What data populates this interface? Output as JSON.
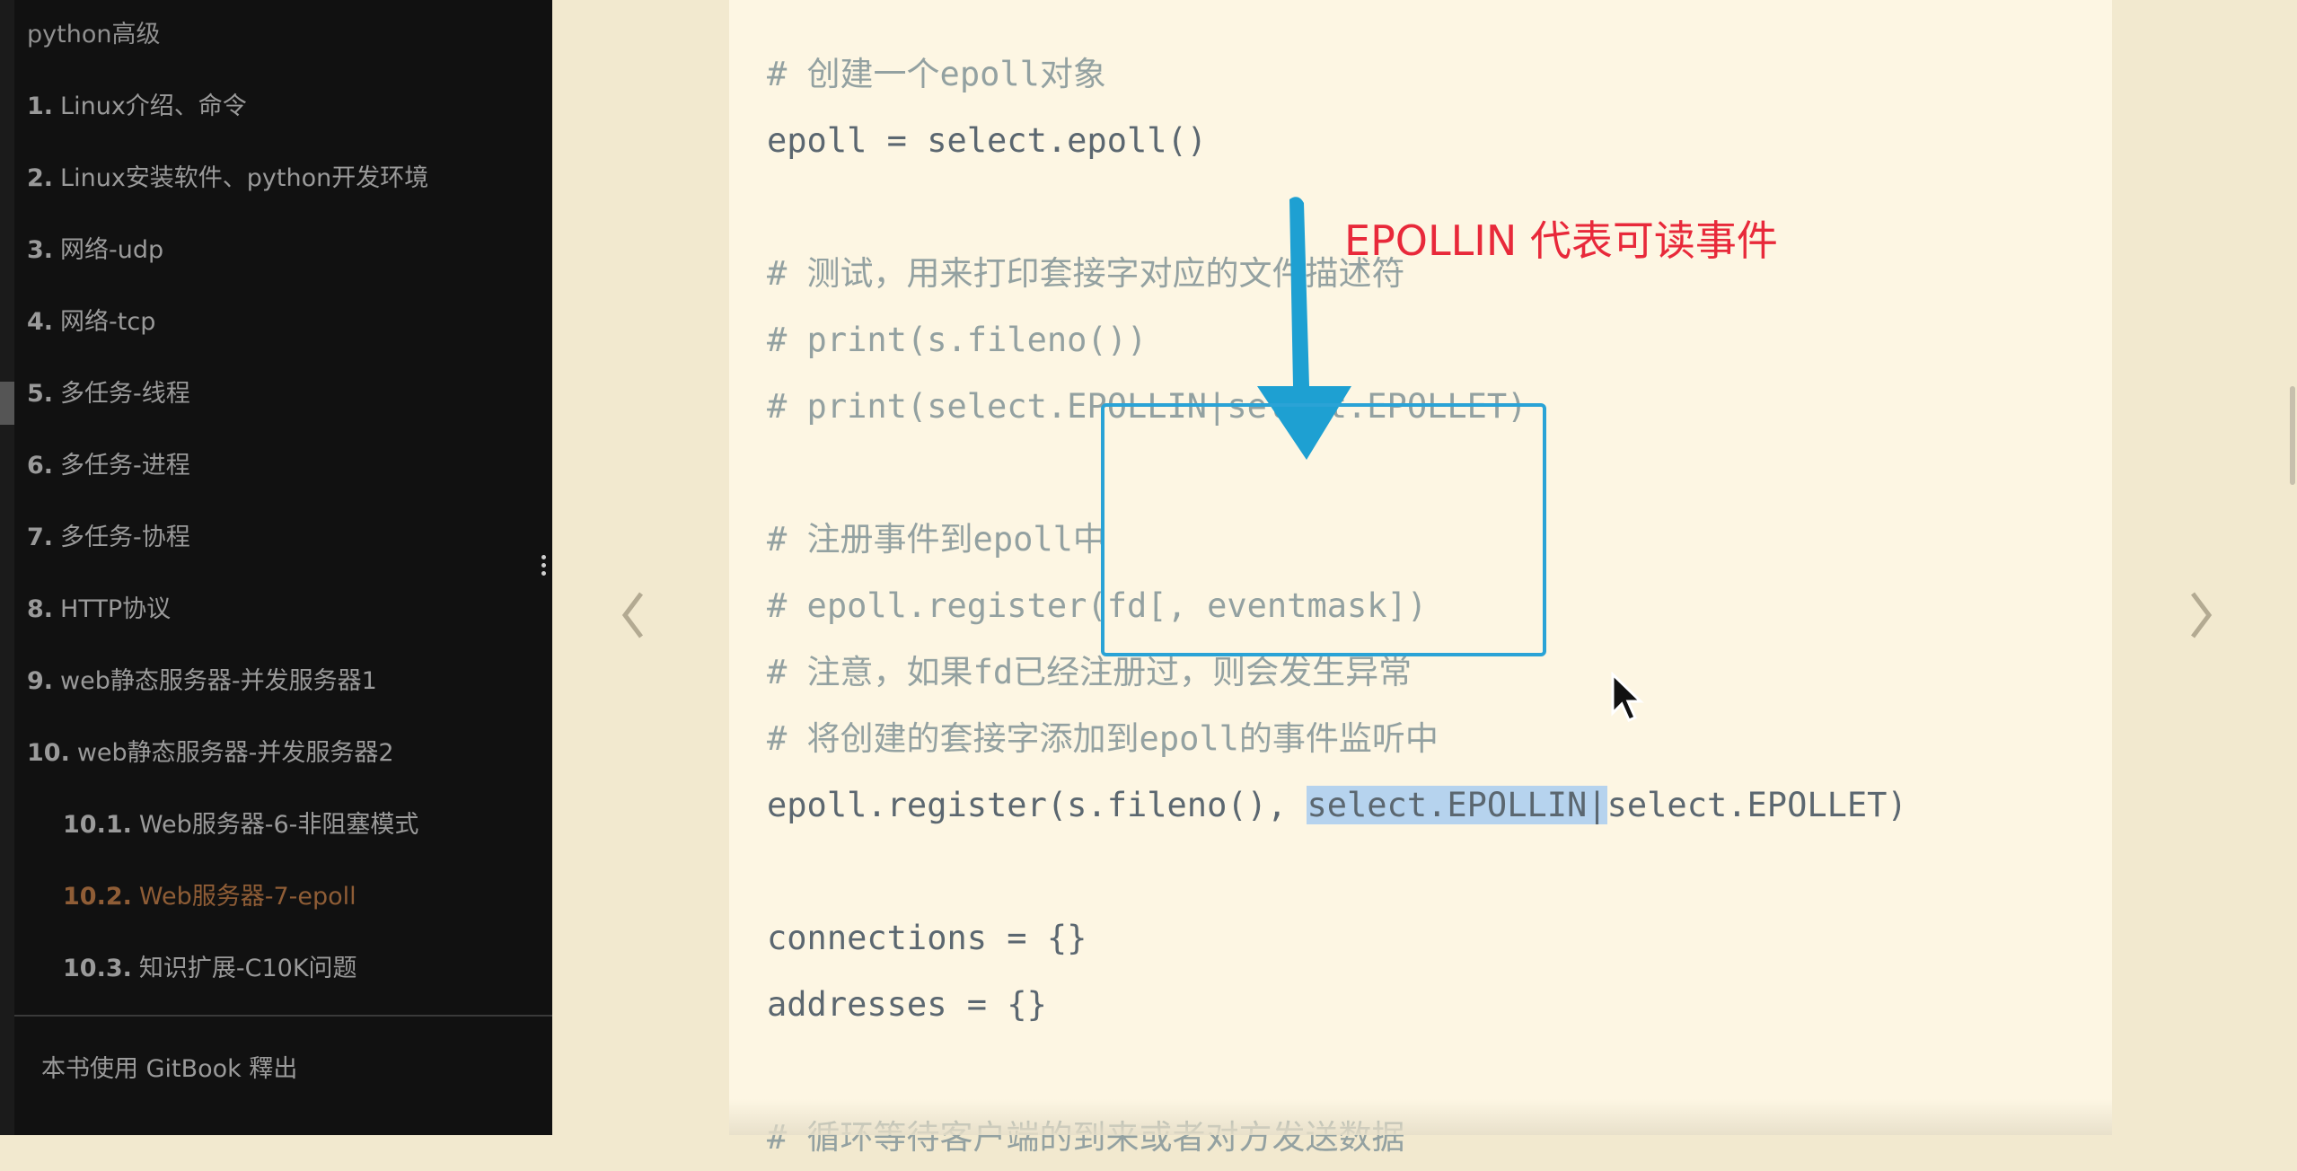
{
  "sidebar": {
    "header": "python高级",
    "items": [
      {
        "num": "1.",
        "label": "Linux介绍、命令"
      },
      {
        "num": "2.",
        "label": "Linux安装软件、python开发环境"
      },
      {
        "num": "3.",
        "label": "网络-udp"
      },
      {
        "num": "4.",
        "label": "网络-tcp"
      },
      {
        "num": "5.",
        "label": "多任务-线程"
      },
      {
        "num": "6.",
        "label": "多任务-进程"
      },
      {
        "num": "7.",
        "label": "多任务-协程"
      },
      {
        "num": "8.",
        "label": "HTTP协议"
      },
      {
        "num": "9.",
        "label": "web静态服务器-并发服务器1"
      },
      {
        "num": "10.",
        "label": "web静态服务器-并发服务器2"
      }
    ],
    "subitems": [
      {
        "num": "10.1.",
        "label": "Web服务器-6-非阻塞模式"
      },
      {
        "num": "10.2.",
        "label": "Web服务器-7-epoll",
        "active": true
      },
      {
        "num": "10.3.",
        "label": "知识扩展-C10K问题"
      }
    ],
    "footer": "本书使用 GitBook 釋出"
  },
  "code": {
    "lines": [
      {
        "text": "# 创建一个epoll对象",
        "type": "comment"
      },
      {
        "text": "epoll = select.epoll()",
        "type": "code"
      },
      {
        "text": "",
        "type": "blank"
      },
      {
        "text": "# 测试，用来打印套接字对应的文件描述符",
        "type": "comment"
      },
      {
        "text": "# print(s.fileno())",
        "type": "comment"
      },
      {
        "text": "# print(select.EPOLLIN|select.EPOLLET)",
        "type": "comment"
      },
      {
        "text": "",
        "type": "blank"
      },
      {
        "text": "# 注册事件到epoll中",
        "type": "comment"
      },
      {
        "text": "# epoll.register(fd[, eventmask])",
        "type": "comment"
      },
      {
        "text": "# 注意，如果fd已经注册过，则会发生异常",
        "type": "comment"
      },
      {
        "text": "# 将创建的套接字添加到epoll的事件监听中",
        "type": "comment"
      },
      {
        "type": "register"
      },
      {
        "text": "",
        "type": "blank"
      },
      {
        "text": "connections = {}",
        "type": "code"
      },
      {
        "text": "addresses = {}",
        "type": "code"
      },
      {
        "text": "",
        "type": "blank"
      },
      {
        "text": "# 循环等待客户端的到来或者对方发送数据",
        "type": "comment"
      }
    ],
    "register_prefix": "epoll.register(s.fileno(), ",
    "register_highlight": "select.EPOLLIN|",
    "register_suffix": "select.EPOLLET)"
  },
  "annotation": {
    "text": "EPOLLIN 代表可读事件",
    "text_color": "#e8293a",
    "arrow_color": "#1ea0d2"
  },
  "navigation": {
    "prev_icon": "chevron-left-icon",
    "next_icon": "chevron-right-icon"
  }
}
